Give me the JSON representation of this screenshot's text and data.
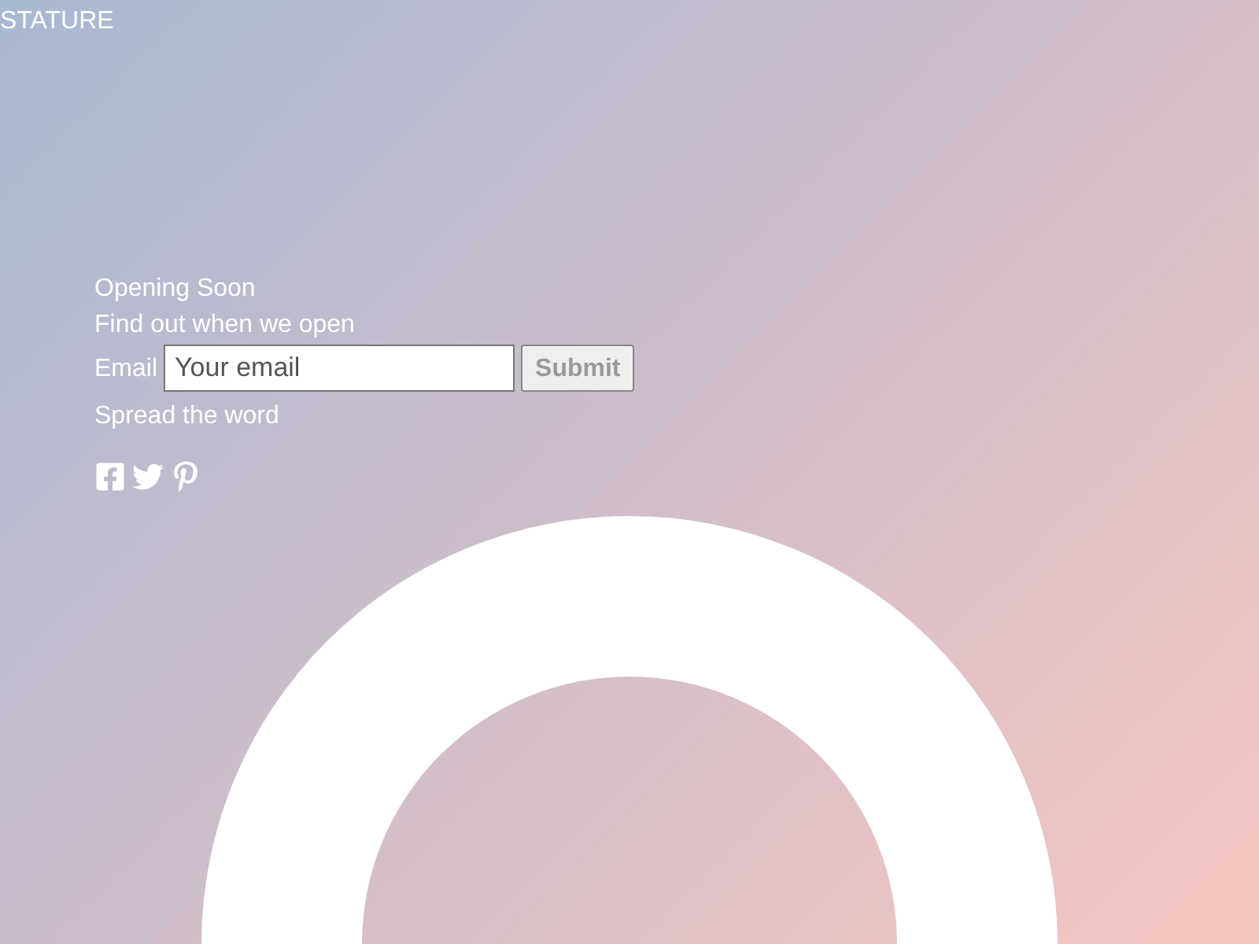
{
  "brand": "STATURE",
  "heading": "Opening Soon",
  "subheading": "Find out when we open",
  "signup": {
    "label": "Email",
    "placeholder": "Your email",
    "button": "Submit",
    "button_disabled": true
  },
  "share": {
    "label": "Spread the word",
    "networks": [
      {
        "kind": "facebook"
      },
      {
        "kind": "twitter"
      },
      {
        "kind": "pinterest"
      }
    ]
  }
}
